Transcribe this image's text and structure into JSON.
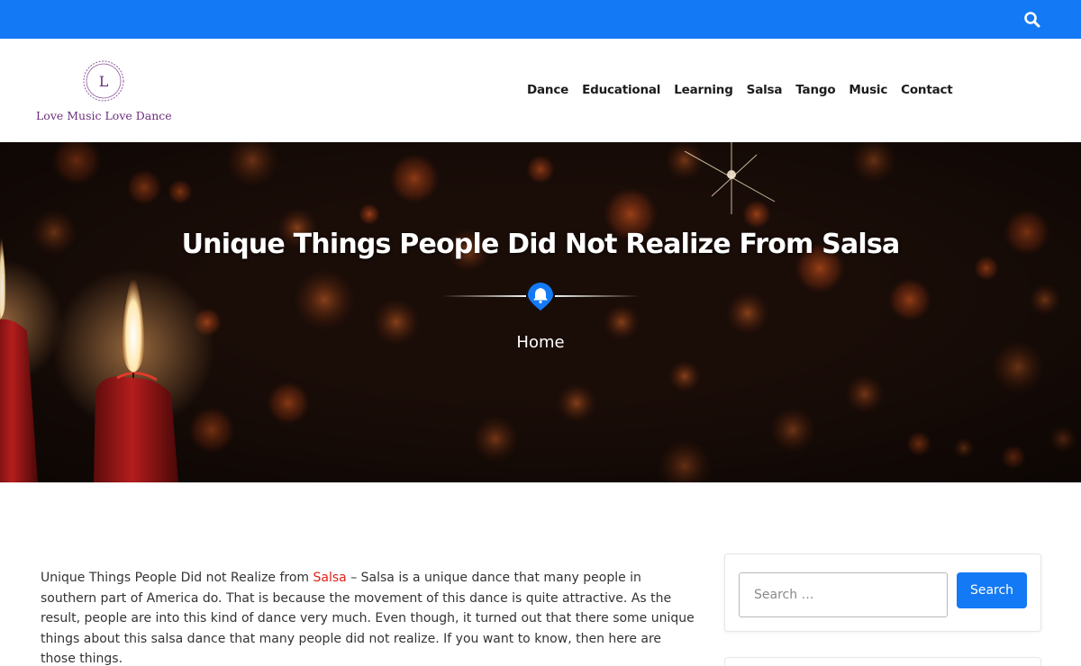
{
  "topbar": {
    "icon": "search-icon",
    "color": "#1479f4"
  },
  "header": {
    "logo_letter": "L",
    "site_name": "Love Music Love Dance",
    "brand_color": "#6b2e7c"
  },
  "nav": {
    "items": [
      "Dance",
      "Educational",
      "Learning",
      "Salsa",
      "Tango",
      "Music",
      "Contact"
    ]
  },
  "hero": {
    "title": "Unique Things People Did Not Realize From Salsa",
    "breadcrumb": "Home",
    "divider_icon": "bell-icon"
  },
  "article": {
    "intro_prefix": "Unique Things People Did not Realize from ",
    "link_text": "Salsa",
    "intro_suffix": " – Salsa is a unique dance that many people in southern part of America do. That is because the movement of this dance is quite attractive. As the result, people are into this kind of dance very much. Even though, it turned out that there some unique things about this salsa dance that many people did not realize. If you want to know, then here are those things.",
    "link_color": "#e0201b"
  },
  "sidebar": {
    "search_placeholder": "Search …",
    "search_button": "Search",
    "accent": "#1479f4"
  }
}
